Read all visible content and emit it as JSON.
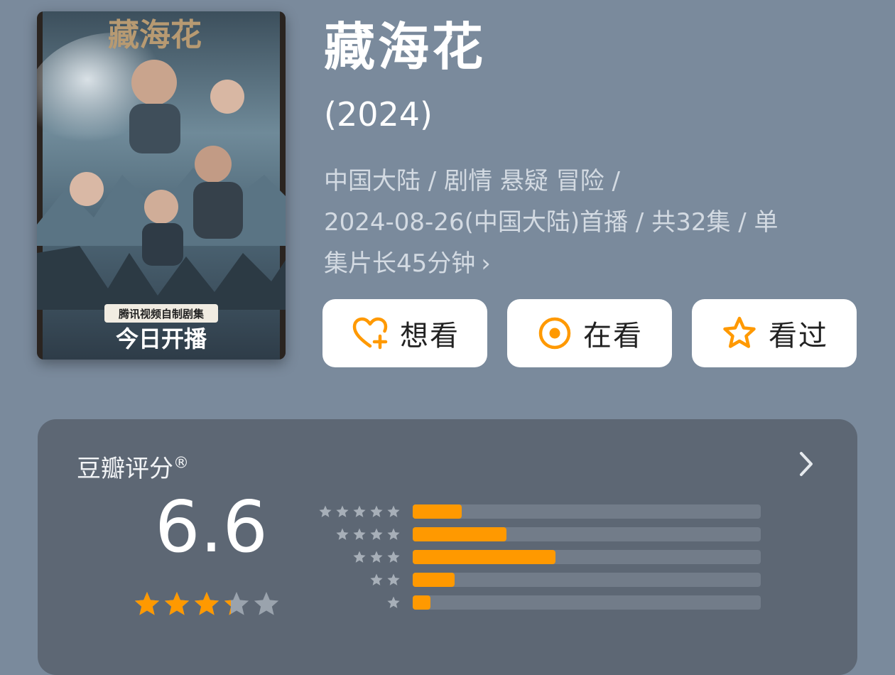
{
  "poster": {
    "title_art": "藏海花",
    "tag": "腾讯视频自制剧集",
    "premiere_text": "今日开播"
  },
  "movie": {
    "title": "藏海花",
    "year": "(2024)",
    "meta_line1": "中国大陆 / 剧情 悬疑 冒险 /",
    "meta_line2": "2024-08-26(中国大陆)首播 / 共32集 / 单",
    "meta_line3": "集片长45分钟",
    "meta_chevron": "›"
  },
  "actions": {
    "want_label": "想看",
    "watching_label": "在看",
    "watched_label": "看过"
  },
  "rating": {
    "title": "豆瓣评分",
    "registered": "®",
    "score": "6.6",
    "score_star_fraction": 0.66,
    "distribution": [
      {
        "stars": 5,
        "fraction": 0.14
      },
      {
        "stars": 4,
        "fraction": 0.27
      },
      {
        "stars": 3,
        "fraction": 0.41
      },
      {
        "stars": 2,
        "fraction": 0.12
      },
      {
        "stars": 1,
        "fraction": 0.05
      }
    ]
  },
  "colors": {
    "background": "#7a8a9c",
    "accent": "#ff9900",
    "card": "#5d6774"
  },
  "icons": {
    "want": "heart-plus-icon",
    "watching": "target-dot-icon",
    "watched": "star-outline-icon",
    "rating_arrow": "chevron-right-icon"
  }
}
